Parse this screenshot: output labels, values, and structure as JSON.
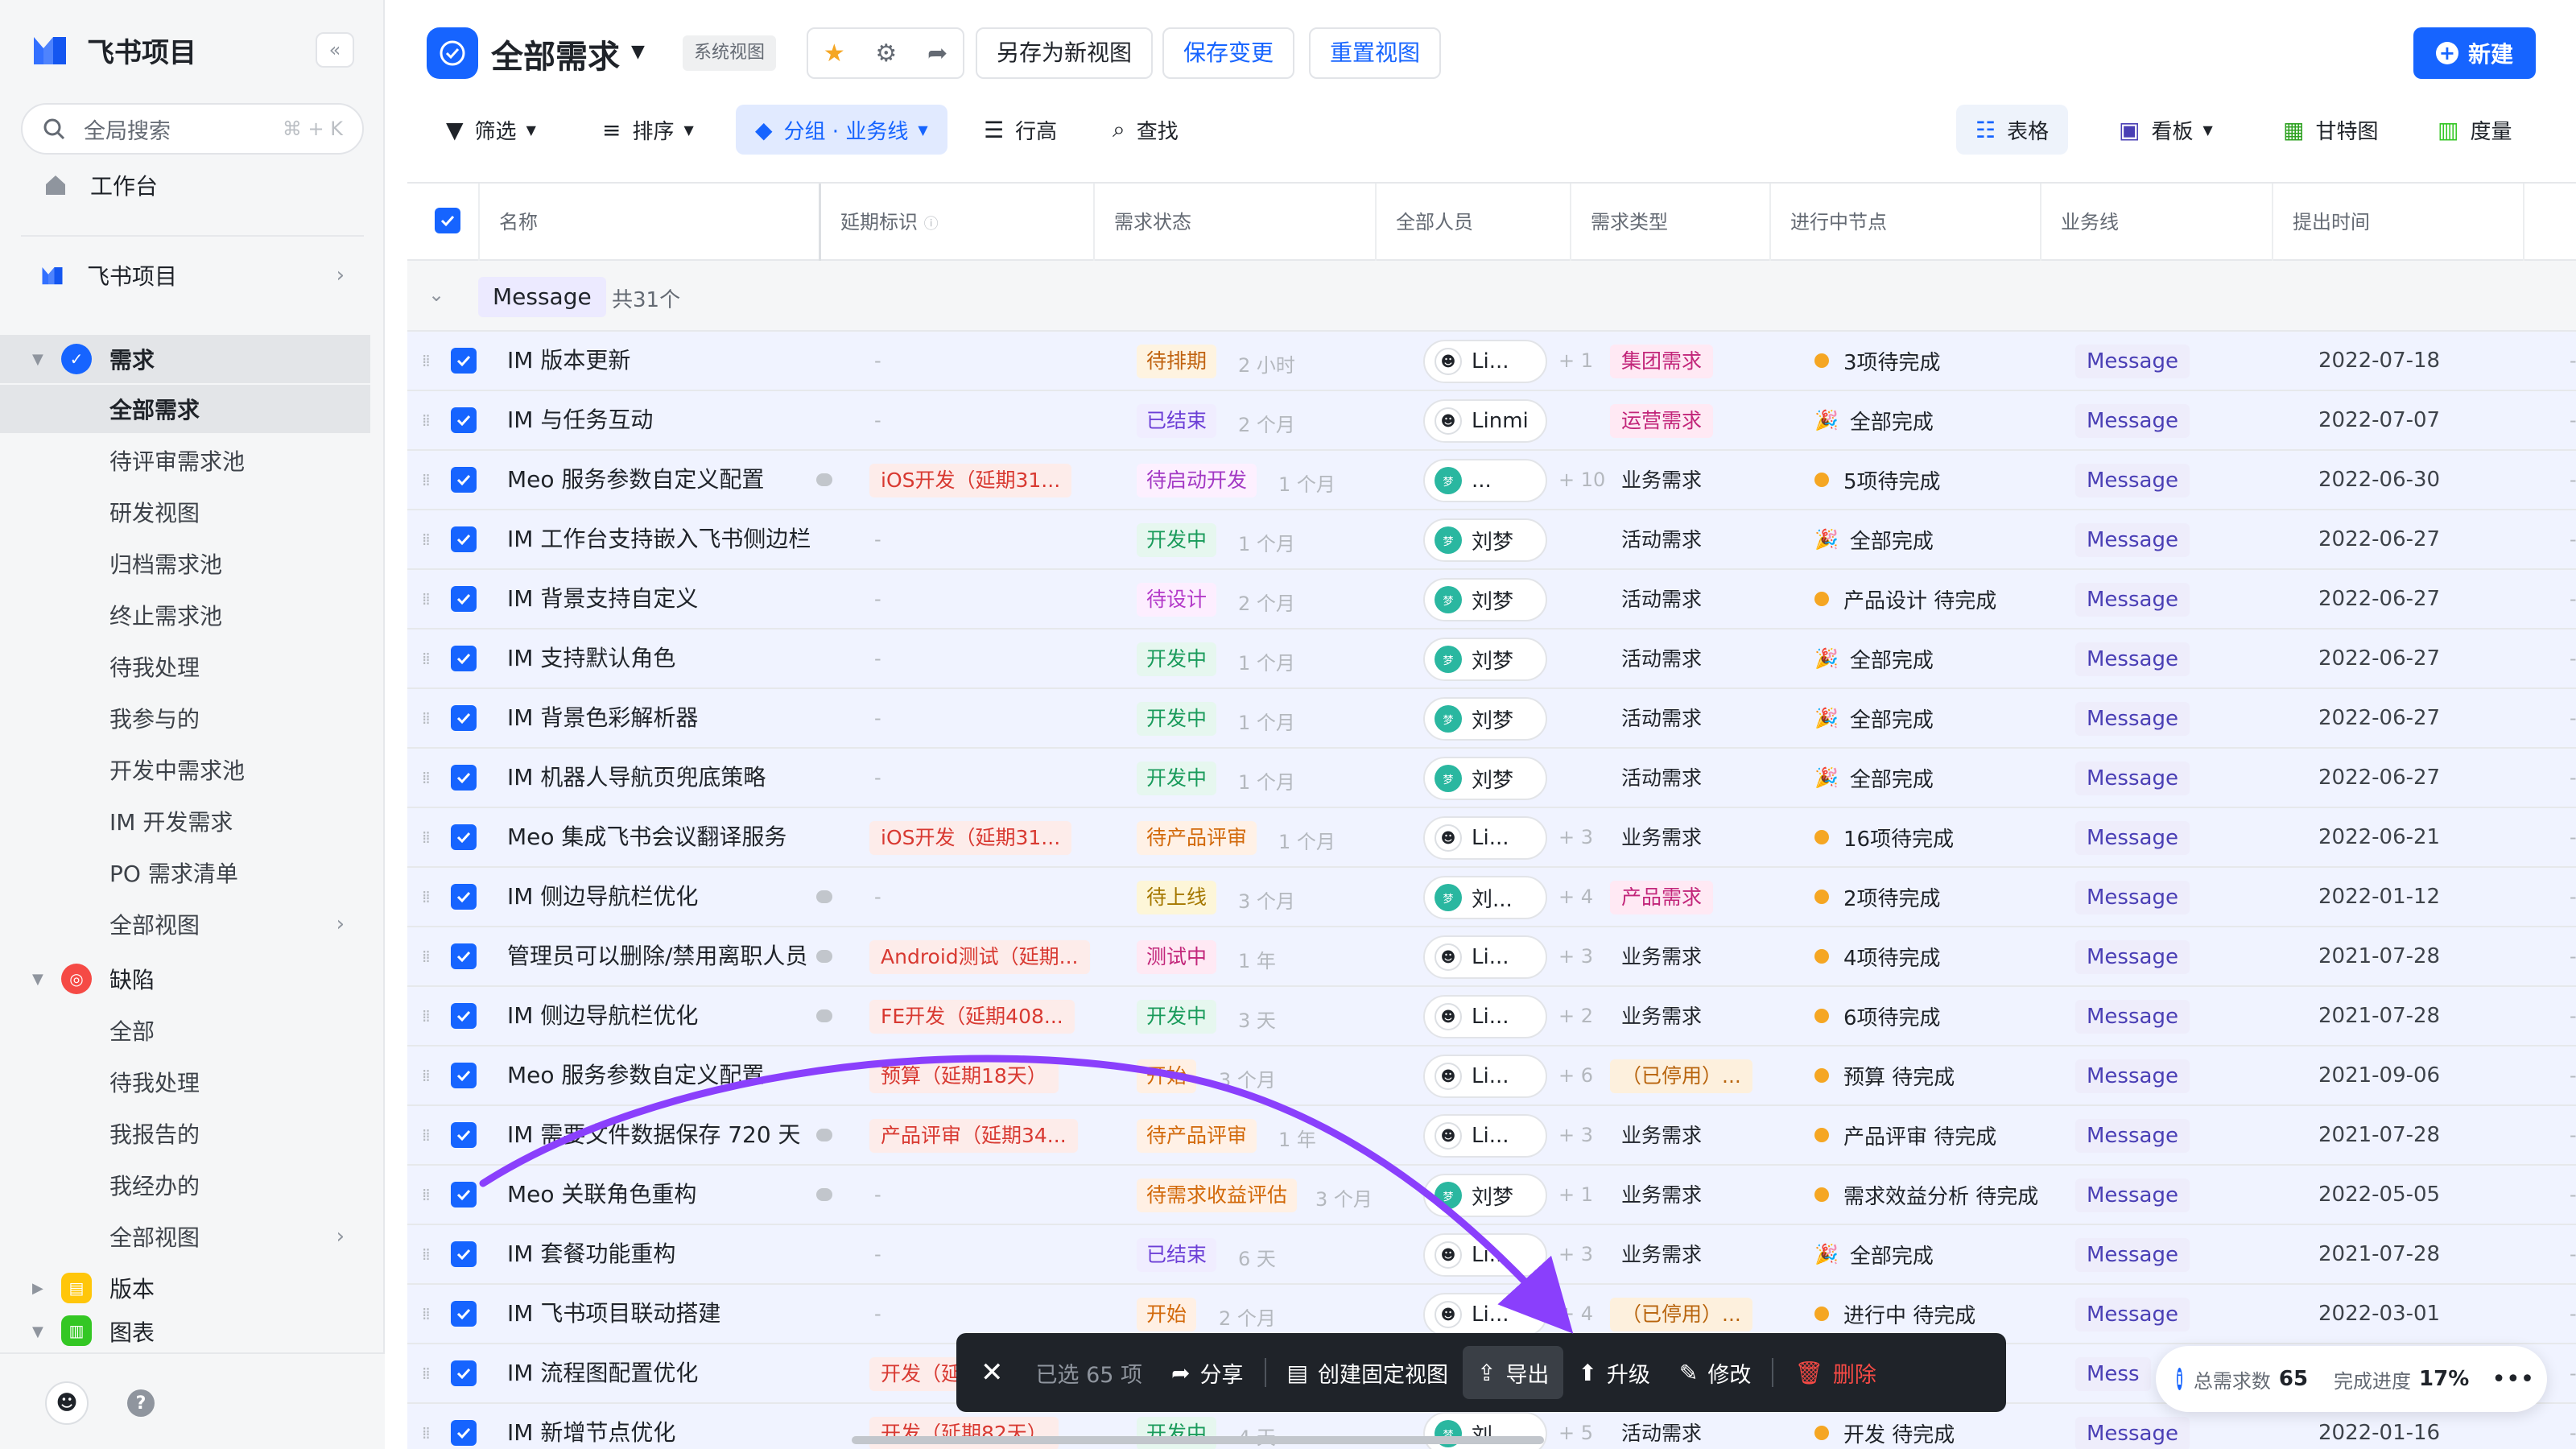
{
  "app": {
    "name": "飞书项目"
  },
  "sidebar": {
    "search_placeholder": "全局搜索",
    "search_shortcut": "⌘ + K",
    "workbench": "工作台",
    "project": "飞书项目",
    "requirements": {
      "label": "需求",
      "items": [
        "全部需求",
        "待评审需求池",
        "研发视图",
        "归档需求池",
        "终止需求池",
        "待我处理",
        "我参与的",
        "开发中需求池",
        "IM 开发需求",
        "PO 需求清单",
        "全部视图"
      ]
    },
    "bugs": {
      "label": "缺陷",
      "items": [
        "全部",
        "待我处理",
        "我报告的",
        "我经办的",
        "全部视图"
      ]
    },
    "version": "版本",
    "charts": "图表"
  },
  "header": {
    "title": "全部需求",
    "badge": "系统视图",
    "save_as_new": "另存为新视图",
    "save_changes": "保存变更",
    "reset_view": "重置视图",
    "new_button": "新建"
  },
  "toolbar": {
    "filter": "筛选",
    "sort": "排序",
    "group": "分组 · 业务线",
    "row_height": "行高",
    "find": "查找",
    "table": "表格",
    "kanban": "看板",
    "gantt": "甘特图",
    "metrics": "度量"
  },
  "table": {
    "columns": [
      "名称",
      "延期标识",
      "需求状态",
      "全部人员",
      "需求类型",
      "进行中节点",
      "业务线",
      "提出时间"
    ],
    "group": {
      "name": "Message",
      "count": "共31个"
    },
    "rows": [
      {
        "name": "IM 版本更新",
        "delay": "-",
        "status": "待排期",
        "time": "2 小时",
        "person": "Li...",
        "more": "+ 1",
        "type": "集团需求",
        "node": "3项待完成",
        "line": "Message",
        "date": "2022-07-18"
      },
      {
        "name": "IM 与任务互动",
        "delay": "-",
        "status": "已结束",
        "time": "2 个月",
        "person": "Linmi",
        "more": "",
        "type": "运营需求",
        "node": "全部完成",
        "line": "Message",
        "date": "2022-07-07"
      },
      {
        "name": "Meo 服务参数自定义配置",
        "delay": "iOS开发（延期31...",
        "status": "待启动开发",
        "time": "1 个月",
        "person": "...",
        "more": "+ 10",
        "type": "业务需求",
        "node": "5项待完成",
        "line": "Message",
        "date": "2022-06-30"
      },
      {
        "name": "IM 工作台支持嵌入飞书侧边栏",
        "delay": "-",
        "status": "开发中",
        "time": "1 个月",
        "person": "刘梦",
        "more": "",
        "type": "活动需求",
        "node": "全部完成",
        "line": "Message",
        "date": "2022-06-27"
      },
      {
        "name": "IM 背景支持自定义",
        "delay": "-",
        "status": "待设计",
        "time": "2 个月",
        "person": "刘梦",
        "more": "",
        "type": "活动需求",
        "node": "产品设计 待完成",
        "line": "Message",
        "date": "2022-06-27"
      },
      {
        "name": "IM 支持默认角色",
        "delay": "-",
        "status": "开发中",
        "time": "1 个月",
        "person": "刘梦",
        "more": "",
        "type": "活动需求",
        "node": "全部完成",
        "line": "Message",
        "date": "2022-06-27"
      },
      {
        "name": "IM 背景色彩解析器",
        "delay": "-",
        "status": "开发中",
        "time": "1 个月",
        "person": "刘梦",
        "more": "",
        "type": "活动需求",
        "node": "全部完成",
        "line": "Message",
        "date": "2022-06-27"
      },
      {
        "name": "IM 机器人导航页兜底策略",
        "delay": "-",
        "status": "开发中",
        "time": "1 个月",
        "person": "刘梦",
        "more": "",
        "type": "活动需求",
        "node": "全部完成",
        "line": "Message",
        "date": "2022-06-27"
      },
      {
        "name": "Meo 集成飞书会议翻译服务",
        "delay": "iOS开发（延期31...",
        "status": "待产品评审",
        "time": "1 个月",
        "person": "Li...",
        "more": "+ 3",
        "type": "业务需求",
        "node": "16项待完成",
        "line": "Message",
        "date": "2022-06-21"
      },
      {
        "name": "IM 侧边导航栏优化",
        "delay": "-",
        "status": "待上线",
        "time": "3 个月",
        "person": "刘...",
        "more": "+ 4",
        "type": "产品需求",
        "node": "2项待完成",
        "line": "Message",
        "date": "2022-01-12"
      },
      {
        "name": "管理员可以删除/禁用离职人员",
        "delay": "Android测试（延期...",
        "status": "测试中",
        "time": "1 年",
        "person": "Li...",
        "more": "+ 3",
        "type": "业务需求",
        "node": "4项待完成",
        "line": "Message",
        "date": "2021-07-28"
      },
      {
        "name": "IM 侧边导航栏优化",
        "delay": "FE开发（延期408...",
        "status": "开发中",
        "time": "3 天",
        "person": "Li...",
        "more": "+ 2",
        "type": "业务需求",
        "node": "6项待完成",
        "line": "Message",
        "date": "2021-07-28"
      },
      {
        "name": "Meo 服务参数自定义配置",
        "delay": "预算（延期18天）",
        "status": "开始",
        "time": "3 个月",
        "person": "Li...",
        "more": "+ 6",
        "type": "（已停用）...",
        "node": "预算 待完成",
        "line": "Message",
        "date": "2021-09-06"
      },
      {
        "name": "IM 需要文件数据保存 720 天",
        "delay": "产品评审（延期34...",
        "status": "待产品评审",
        "time": "1 年",
        "person": "Li...",
        "more": "+ 3",
        "type": "业务需求",
        "node": "产品评审 待完成",
        "line": "Message",
        "date": "2021-07-28"
      },
      {
        "name": "Meo 关联角色重构",
        "delay": "-",
        "status": "待需求收益评估",
        "time": "3 个月",
        "person": "刘梦",
        "more": "+ 1",
        "type": "业务需求",
        "node": "需求效益分析 待完成",
        "line": "Message",
        "date": "2022-05-05"
      },
      {
        "name": "IM 套餐功能重构",
        "delay": "-",
        "status": "已结束",
        "time": "6 天",
        "person": "Li...",
        "more": "+ 3",
        "type": "业务需求",
        "node": "全部完成",
        "line": "Message",
        "date": "2021-07-28"
      },
      {
        "name": "IM 飞书项目联动搭建",
        "delay": "-",
        "status": "开始",
        "time": "2 个月",
        "person": "Li...",
        "more": "+ 4",
        "type": "（已停用）...",
        "node": "进行中 待完成",
        "line": "Message",
        "date": "2022-03-01"
      },
      {
        "name": "IM 流程图配置优化",
        "delay": "开发（延",
        "status": "",
        "time": "",
        "person": "",
        "more": "",
        "type": "",
        "node": "",
        "line": "Mess",
        "date": ""
      },
      {
        "name": "IM 新增节点优化",
        "delay": "开发（延期82天）",
        "status": "开发中",
        "time": "4 天",
        "person": "刘...",
        "more": "+ 5",
        "type": "活动需求",
        "node": "开发 待完成",
        "line": "Message",
        "date": "2022-01-16"
      }
    ]
  },
  "action_bar": {
    "selected": "已选 65 项",
    "share": "分享",
    "create_fixed_view": "创建固定视图",
    "export": "导出",
    "upgrade": "升级",
    "modify": "修改",
    "delete": "删除"
  },
  "summary": {
    "total_label": "总需求数",
    "total": "65",
    "progress_label": "完成进度",
    "progress": "17%"
  }
}
